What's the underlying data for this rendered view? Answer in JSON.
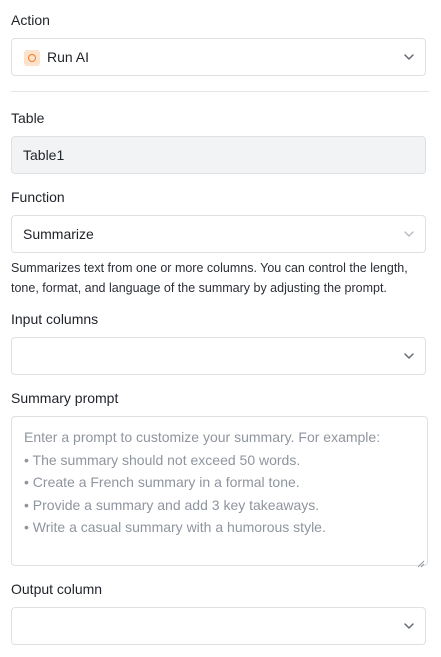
{
  "action": {
    "label": "Action",
    "value": "Run AI",
    "icon": "run-ai-icon"
  },
  "table": {
    "label": "Table",
    "value": "Table1"
  },
  "function": {
    "label": "Function",
    "value": "Summarize",
    "description": "Summarizes text from one or more columns. You can control the length, tone, format, and language of the summary by adjusting the prompt."
  },
  "input_columns": {
    "label": "Input columns",
    "value": ""
  },
  "summary_prompt": {
    "label": "Summary prompt",
    "placeholder": "Enter a prompt to customize your summary. For example:\n• The summary should not exceed 50 words.\n• Create a French summary in a formal tone.\n• Provide a summary and add 3 key takeaways.\n• Write a casual summary with a humorous style."
  },
  "output_column": {
    "label": "Output column",
    "value": ""
  },
  "colors": {
    "accent": "#f07c2a",
    "border": "#dee0e3",
    "readonly_bg": "#f2f3f5",
    "placeholder": "#8f959e"
  }
}
